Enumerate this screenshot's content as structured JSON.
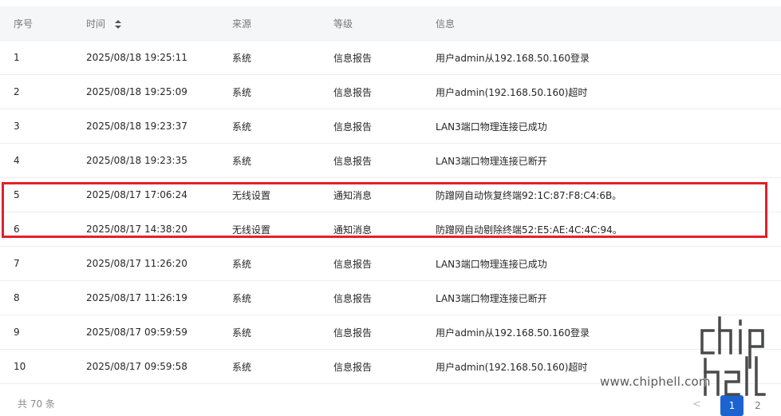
{
  "table": {
    "headers": {
      "num": "序号",
      "time": "时间",
      "source": "来源",
      "level": "等级",
      "info": "信息"
    },
    "rows": [
      {
        "num": "1",
        "time": "2025/08/18 19:25:11",
        "source": "系统",
        "level": "信息报告",
        "info": "用户admin从192.168.50.160登录"
      },
      {
        "num": "2",
        "time": "2025/08/18 19:25:09",
        "source": "系统",
        "level": "信息报告",
        "info": "用户admin(192.168.50.160)超时"
      },
      {
        "num": "3",
        "time": "2025/08/18 19:23:37",
        "source": "系统",
        "level": "信息报告",
        "info": "LAN3端口物理连接已成功"
      },
      {
        "num": "4",
        "time": "2025/08/18 19:23:35",
        "source": "系统",
        "level": "信息报告",
        "info": "LAN3端口物理连接已断开"
      },
      {
        "num": "5",
        "time": "2025/08/17 17:06:24",
        "source": "无线设置",
        "level": "通知消息",
        "info": "防蹭网自动恢复终端92:1C:87:F8:C4:6B。"
      },
      {
        "num": "6",
        "time": "2025/08/17 14:38:20",
        "source": "无线设置",
        "level": "通知消息",
        "info": "防蹭网自动剔除终端52:E5:AE:4C:4C:94。"
      },
      {
        "num": "7",
        "time": "2025/08/17 11:26:20",
        "source": "系统",
        "level": "信息报告",
        "info": "LAN3端口物理连接已成功"
      },
      {
        "num": "8",
        "time": "2025/08/17 11:26:19",
        "source": "系统",
        "level": "信息报告",
        "info": "LAN3端口物理连接已断开"
      },
      {
        "num": "9",
        "time": "2025/08/17 09:59:59",
        "source": "系统",
        "level": "信息报告",
        "info": "用户admin从192.168.50.160登录"
      },
      {
        "num": "10",
        "time": "2025/08/17 09:59:58",
        "source": "系统",
        "level": "信息报告",
        "info": "用户admin(192.168.50.160)超时"
      }
    ]
  },
  "footer": {
    "total": "共 70 条",
    "prev": "<",
    "pages": [
      "1",
      "2"
    ],
    "current_page": "1"
  },
  "watermark": {
    "text": "www.chiphell.com",
    "icon": "chiphell-logo"
  },
  "colors": {
    "highlight": "#e4202a",
    "active_page": "#1b63d1",
    "header_bg": "#f5f6f8"
  }
}
